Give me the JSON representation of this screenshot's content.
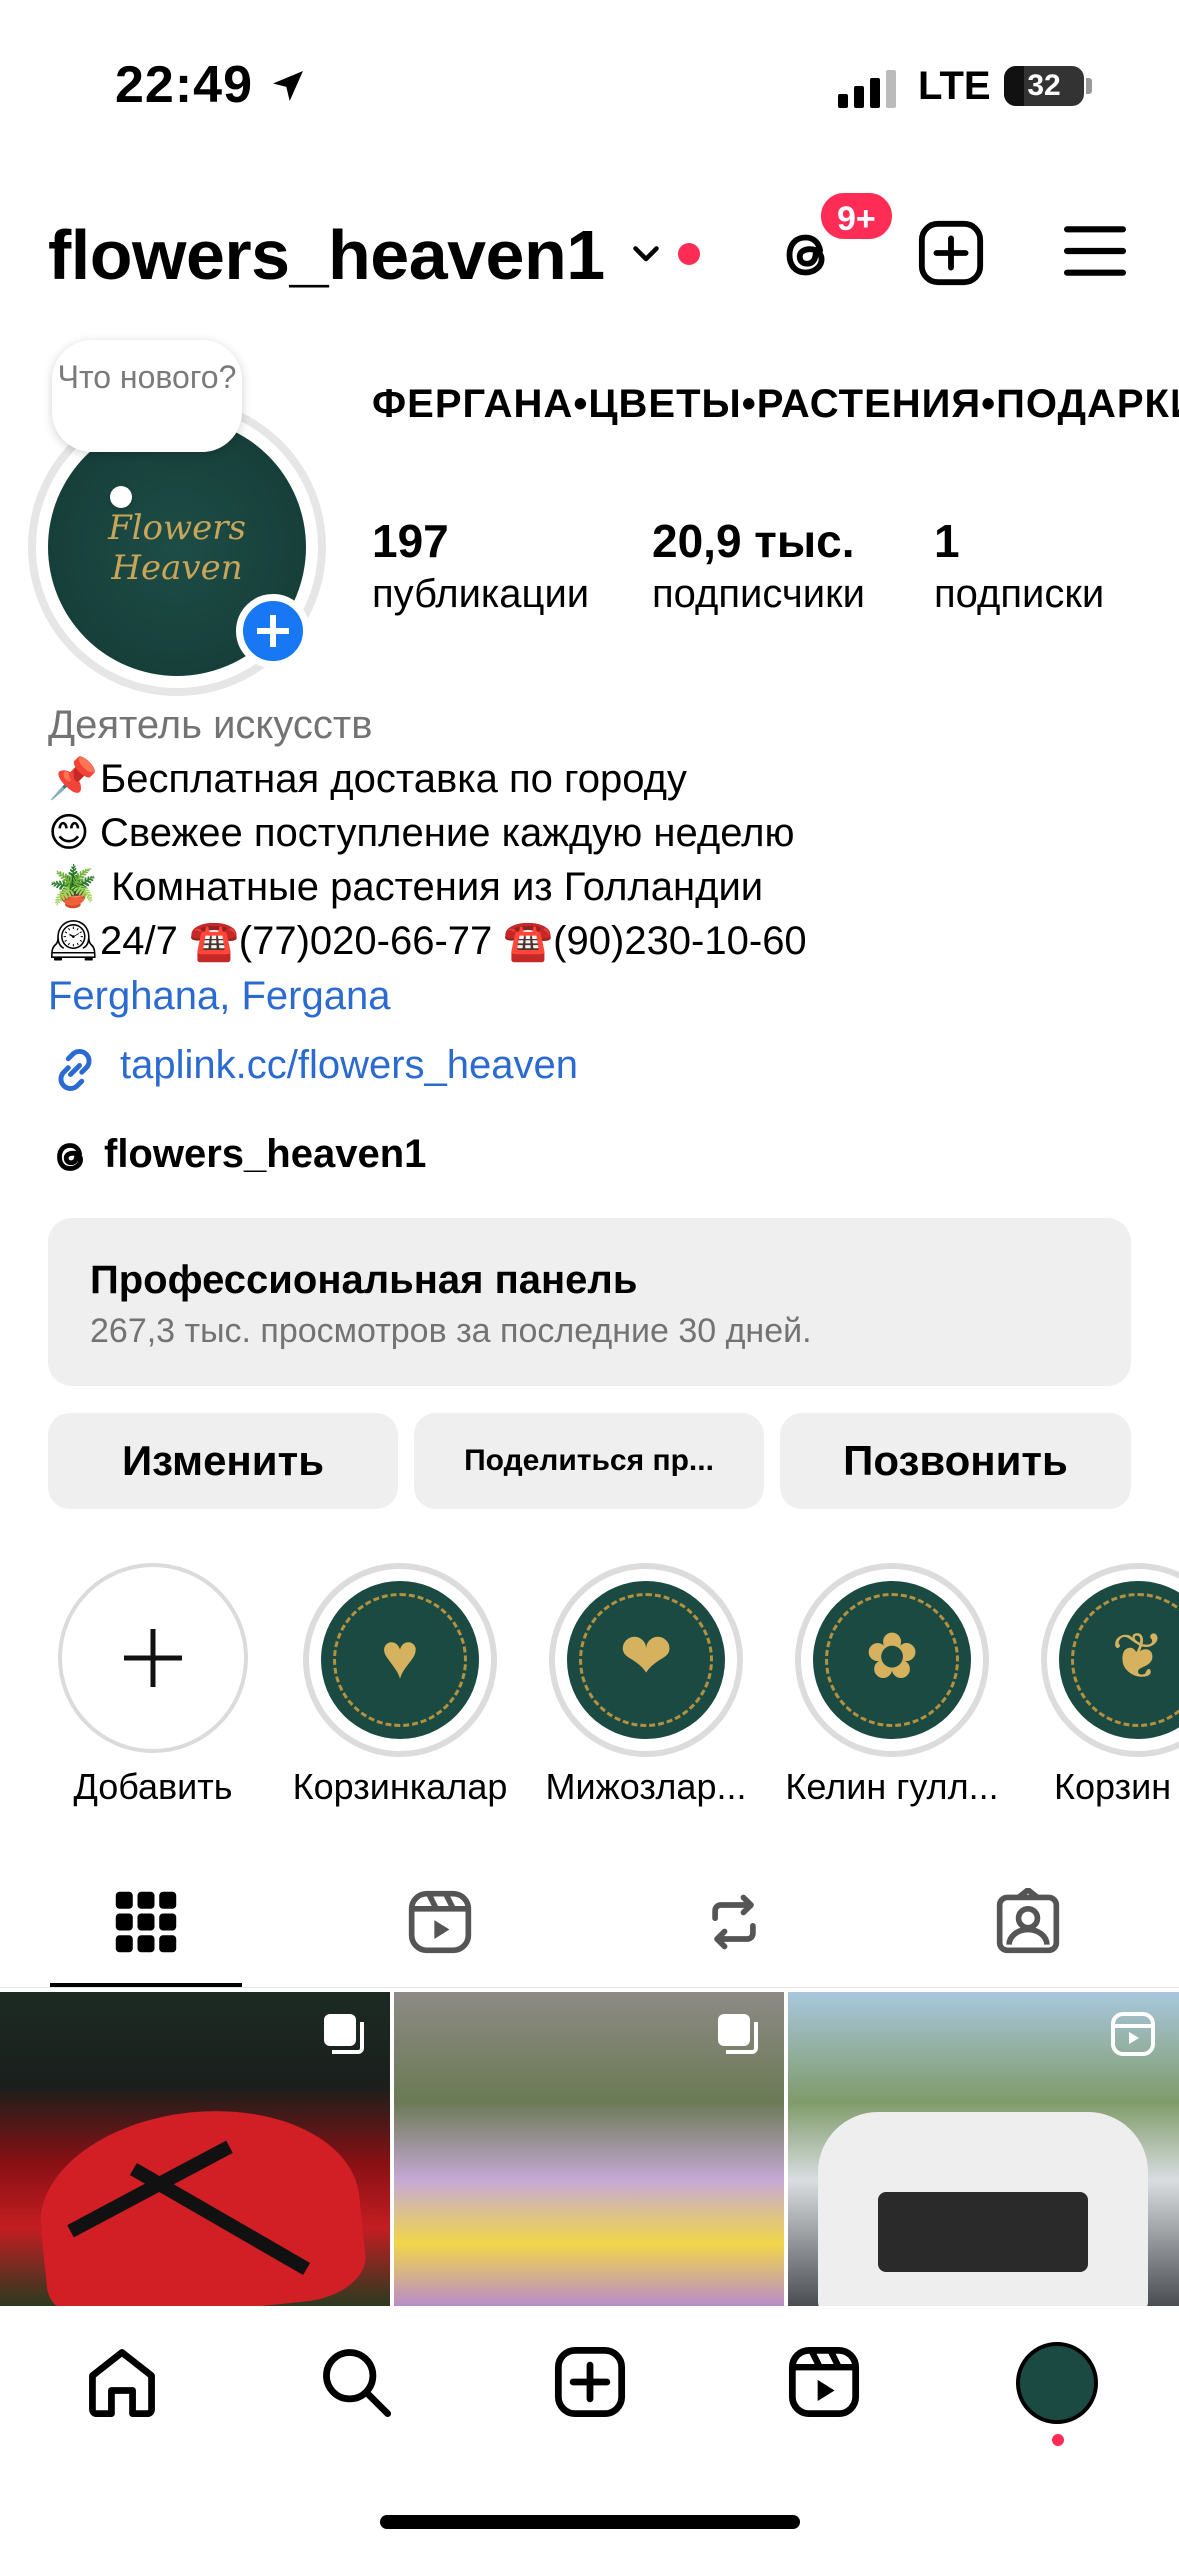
{
  "status_bar": {
    "time": "22:49",
    "network": "LTE",
    "battery": "32"
  },
  "header": {
    "username": "flowers_heaven1",
    "notification_badge": "9+"
  },
  "profile": {
    "note": "Что нового?",
    "avatar_text": "Flowers Heaven",
    "name": "ФЕРГАНА•ЦВЕТЫ•РАСТЕНИЯ•ПОДАРКИ",
    "stats": [
      {
        "value": "197",
        "label": "публикации"
      },
      {
        "value": "20,9 тыс.",
        "label": "подписчики"
      },
      {
        "value": "1",
        "label": "подписки"
      }
    ],
    "category": "Деятель искусств",
    "bio": [
      {
        "emoji": "📌",
        "text": "Бесплатная доставка по городу"
      },
      {
        "emoji": "😊",
        "text": "Свежее поступление каждую неделю"
      },
      {
        "emoji": "🪴",
        "text": " Комнатные растения из Голландии"
      },
      {
        "emoji": "🕰",
        "text": "24/7 ☎️(77)020-66-77 ☎️(90)230-10-60"
      }
    ],
    "location": "Ferghana, Fergana",
    "link": "taplink.cc/flowers_heaven",
    "threads_handle": "flowers_heaven1"
  },
  "pro_panel": {
    "title": "Профессиональная панель",
    "subtitle": "267,3 тыс. просмотров за последние 30 дней."
  },
  "buttons": {
    "edit": "Изменить",
    "share": "Поделиться пр...",
    "call": "Позвонить"
  },
  "highlights": [
    {
      "label": "Добавить",
      "icon": "plus-icon"
    },
    {
      "label": "Корзинкалар",
      "icon": "basket-icon"
    },
    {
      "label": "Мижозлар...",
      "icon": "hearts-icon"
    },
    {
      "label": "Келин гулл...",
      "icon": "bouquet-icon"
    },
    {
      "label": "Корзин",
      "icon": "gift-icon"
    }
  ],
  "tabs": [
    "grid-icon",
    "reels-icon",
    "reposts-icon",
    "tagged-icon"
  ],
  "bottom_nav": [
    "home-icon",
    "search-icon",
    "create-icon",
    "reels-icon",
    "profile-avatar"
  ]
}
